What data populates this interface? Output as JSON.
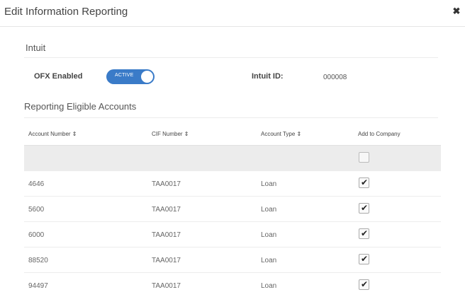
{
  "modal": {
    "title": "Edit Information Reporting",
    "close_icon": "close-x-icon"
  },
  "intuit": {
    "section_title": "Intuit",
    "ofx_label": "OFX Enabled",
    "toggle_text": "ACTIVE",
    "toggle_on": true,
    "intuit_id_label": "Intuit ID:",
    "intuit_id_value": "000008"
  },
  "reporting": {
    "section_title": "Reporting Eligible Accounts",
    "columns": [
      "Account Number ⇕",
      "CIF Number ⇕",
      "Account Type ⇕",
      "Add to Company"
    ],
    "select_all_checked": false,
    "rows": [
      {
        "account": "4646",
        "cif": "TAA0017",
        "type": "Loan",
        "checked": true
      },
      {
        "account": "5600",
        "cif": "TAA0017",
        "type": "Loan",
        "checked": true
      },
      {
        "account": "6000",
        "cif": "TAA0017",
        "type": "Loan",
        "checked": true
      },
      {
        "account": "88520",
        "cif": "TAA0017",
        "type": "Loan",
        "checked": true
      },
      {
        "account": "94497",
        "cif": "TAA0017",
        "type": "Loan",
        "checked": true
      }
    ]
  },
  "colors": {
    "toggle_active": "#3a7bc8",
    "filter_row_bg": "#ececec"
  }
}
